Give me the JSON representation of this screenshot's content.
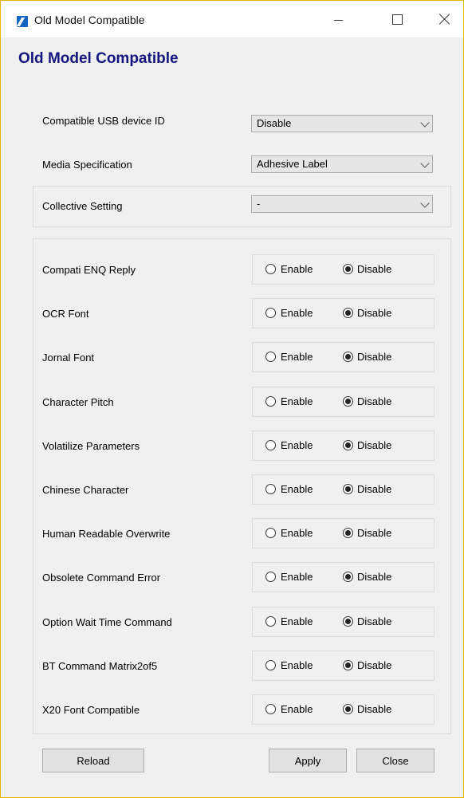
{
  "window": {
    "title": "Old Model Compatible"
  },
  "heading": "Old Model Compatible",
  "settings": {
    "usb_id": {
      "label": "Compatible USB device ID",
      "value": "Disable"
    },
    "media": {
      "label": "Media Specification",
      "value": "Adhesive Label"
    },
    "collective": {
      "label": "Collective Setting",
      "value": "-"
    }
  },
  "radio_labels": {
    "enable": "Enable",
    "disable": "Disable"
  },
  "options": [
    {
      "label": "Compati ENQ Reply",
      "selected": "Disable"
    },
    {
      "label": "OCR Font",
      "selected": "Disable"
    },
    {
      "label": "Jornal Font",
      "selected": "Disable"
    },
    {
      "label": "Character Pitch",
      "selected": "Disable"
    },
    {
      "label": "Volatilize Parameters",
      "selected": "Disable"
    },
    {
      "label": "Chinese Character",
      "selected": "Disable"
    },
    {
      "label": "Human Readable Overwrite",
      "selected": "Disable"
    },
    {
      "label": "Obsolete Command Error",
      "selected": "Disable"
    },
    {
      "label": "Option Wait Time Command",
      "selected": "Disable"
    },
    {
      "label": "BT Command Matrix2of5",
      "selected": "Disable"
    },
    {
      "label": "X20 Font Compatible",
      "selected": "Disable"
    }
  ],
  "buttons": {
    "reload": "Reload",
    "apply": "Apply",
    "close": "Close"
  }
}
